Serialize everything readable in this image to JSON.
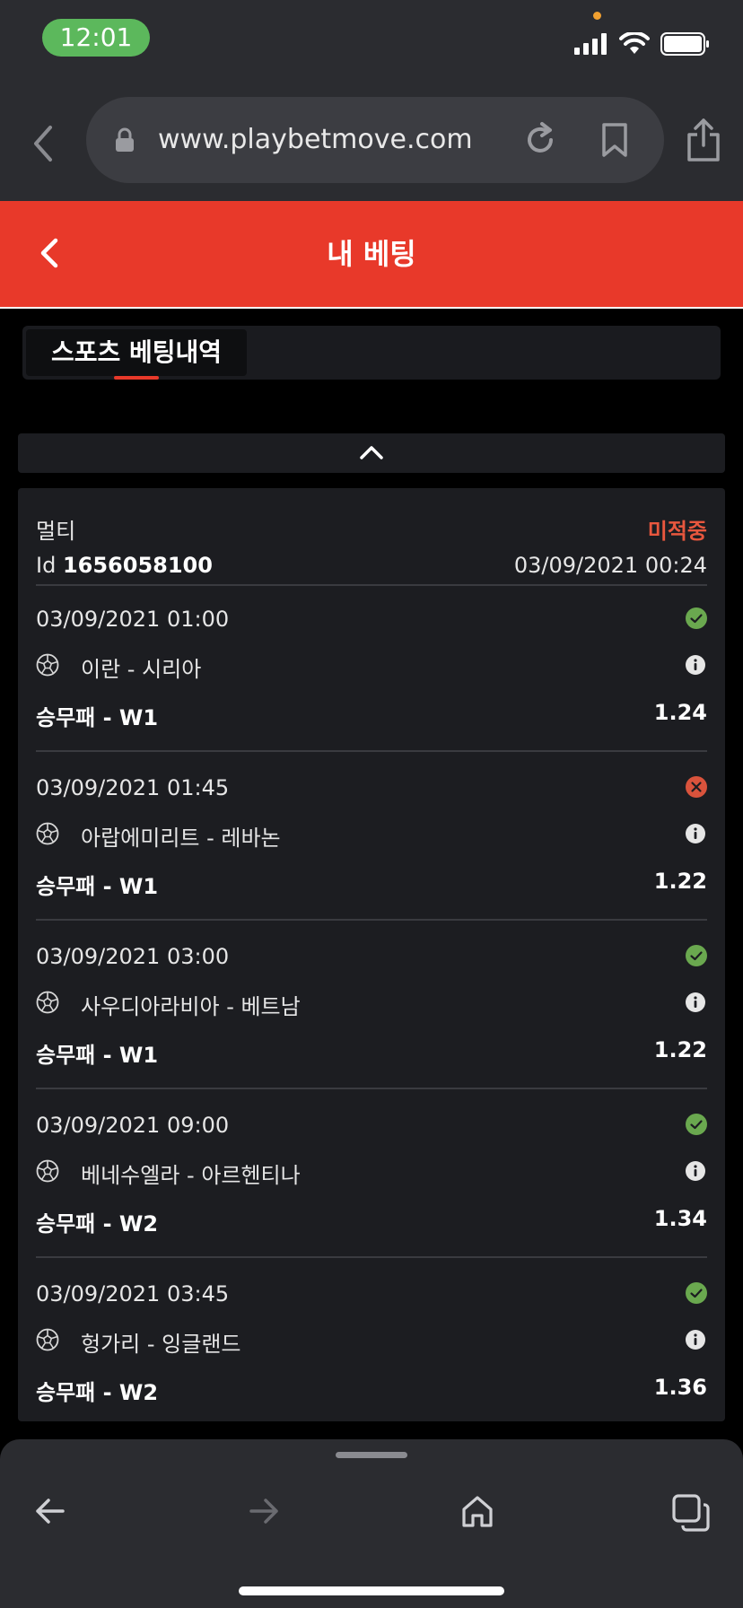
{
  "status_bar": {
    "time": "12:01"
  },
  "browser": {
    "url": "www.playbetmove.com"
  },
  "header": {
    "title": "내 베팅"
  },
  "tabs": [
    {
      "label": "스포츠 베팅내역",
      "active": true
    }
  ],
  "ticket": {
    "type": "멀티",
    "status": "미적중",
    "id_label": "Id",
    "id_value": "1656058100",
    "placed_at": "03/09/2021 00:24",
    "bets": [
      {
        "date": "03/09/2021 01:00",
        "match": "이란 - 시리아",
        "market": "승무패 - W1",
        "odds": "1.24",
        "result": "won"
      },
      {
        "date": "03/09/2021 01:45",
        "match": "아랍에미리트 - 레바논",
        "market": "승무패 - W1",
        "odds": "1.22",
        "result": "lost"
      },
      {
        "date": "03/09/2021 03:00",
        "match": "사우디아라비아 - 베트남",
        "market": "승무패 - W1",
        "odds": "1.22",
        "result": "won"
      },
      {
        "date": "03/09/2021 09:00",
        "match": "베네수엘라 - 아르헨티나",
        "market": "승무패 - W2",
        "odds": "1.34",
        "result": "won"
      },
      {
        "date": "03/09/2021 03:45",
        "match": "헝가리 - 잉글랜드",
        "market": "승무패 - W2",
        "odds": "1.36",
        "result": "won"
      }
    ]
  },
  "colors": {
    "accent": "#e8392a",
    "won": "#6aa84f",
    "lost": "#d9533c"
  }
}
